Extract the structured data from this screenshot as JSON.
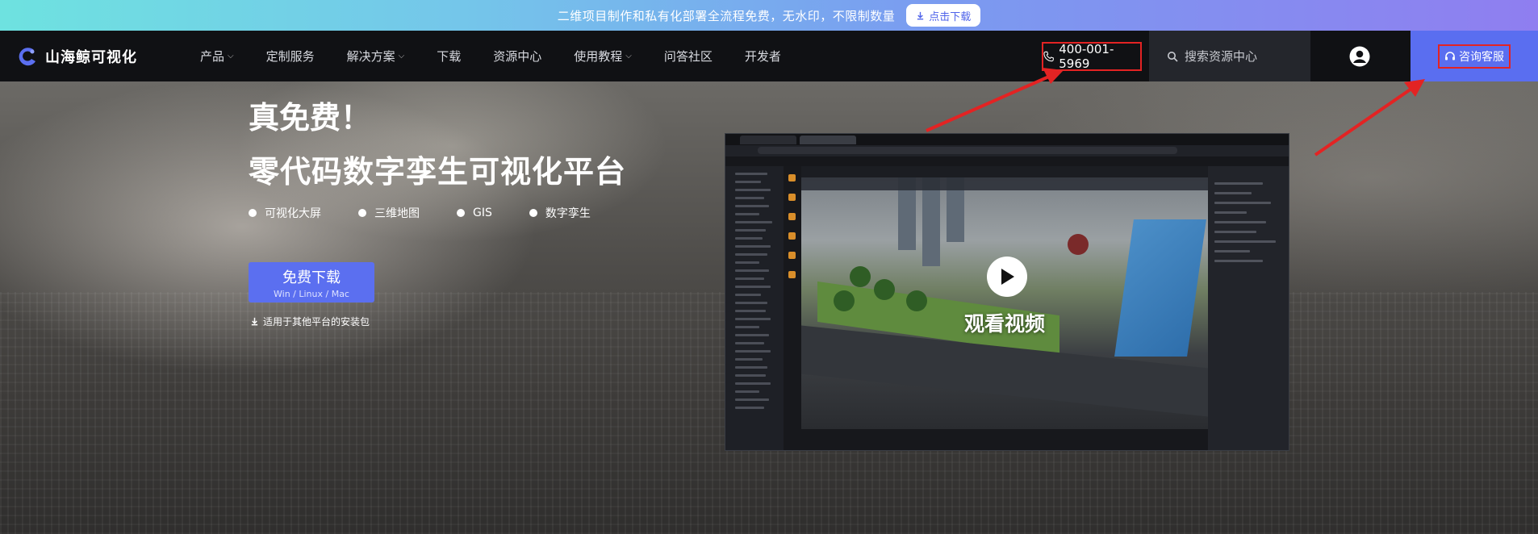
{
  "promo": {
    "text": "二维项目制作和私有化部署全流程免费，无水印，不限制数量",
    "button_label": "点击下载"
  },
  "brand": {
    "name": "山海鲸可视化",
    "accent": "#5b6ff0"
  },
  "nav": {
    "items": [
      {
        "label": "产品",
        "dropdown": true
      },
      {
        "label": "定制服务",
        "dropdown": false
      },
      {
        "label": "解决方案",
        "dropdown": true
      },
      {
        "label": "下载",
        "dropdown": false
      },
      {
        "label": "资源中心",
        "dropdown": false
      },
      {
        "label": "使用教程",
        "dropdown": true
      },
      {
        "label": "问答社区",
        "dropdown": false
      },
      {
        "label": "开发者",
        "dropdown": false
      }
    ],
    "phone": "400-001-5969",
    "search_placeholder": "搜索资源中心",
    "consult_label": "咨询客服"
  },
  "hero": {
    "tagline": "真免费！",
    "title": "零代码数字孪生可视化平台",
    "features": [
      "可视化大屏",
      "三维地图",
      "GIS",
      "数字孪生"
    ],
    "download_label": "免费下载",
    "download_platforms": "Win / Linux / Mac",
    "other_platforms_link": "适用于其他平台的安装包"
  },
  "video": {
    "label": "观看视频"
  },
  "annotation_color": "#e32323"
}
